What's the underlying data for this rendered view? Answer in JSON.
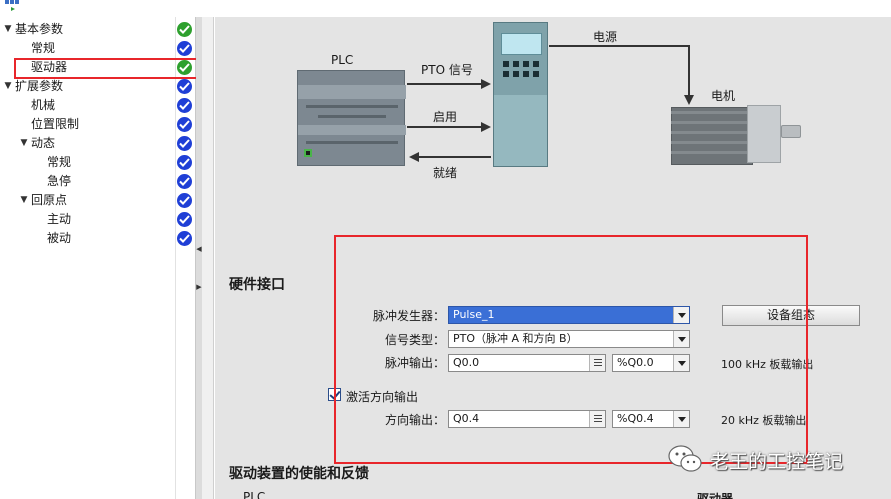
{
  "tree": {
    "items": [
      {
        "label": "基本参数",
        "level": 0,
        "expanded": true,
        "status": "ok"
      },
      {
        "label": "常规",
        "level": 1,
        "expanded": null,
        "status": "blue"
      },
      {
        "label": "驱动器",
        "level": 1,
        "expanded": null,
        "status": "ok",
        "selected": true
      },
      {
        "label": "扩展参数",
        "level": 0,
        "expanded": true,
        "status": "blue"
      },
      {
        "label": "机械",
        "level": 1,
        "expanded": null,
        "status": "blue"
      },
      {
        "label": "位置限制",
        "level": 1,
        "expanded": null,
        "status": "blue"
      },
      {
        "label": "动态",
        "level": 1,
        "expanded": true,
        "status": "blue"
      },
      {
        "label": "常规",
        "level": 2,
        "expanded": null,
        "status": "blue"
      },
      {
        "label": "急停",
        "level": 2,
        "expanded": null,
        "status": "blue"
      },
      {
        "label": "回原点",
        "level": 1,
        "expanded": true,
        "status": "blue"
      },
      {
        "label": "主动",
        "level": 2,
        "expanded": null,
        "status": "blue"
      },
      {
        "label": "被动",
        "level": 2,
        "expanded": null,
        "status": "blue"
      }
    ]
  },
  "diagram": {
    "plc_label": "PLC",
    "power_label": "电源",
    "motor_label": "电机",
    "pto_label": "PTO 信号",
    "enable_label": "启用",
    "ready_label": "就绪"
  },
  "hardware": {
    "title": "硬件接口",
    "pulse_generator_label": "脉冲发生器：",
    "pulse_generator_value": "Pulse_1",
    "config_button": "设备组态",
    "signal_type_label": "信号类型：",
    "signal_type_value": "PTO（脉冲 A 和方向 B）",
    "pulse_output_label": "脉冲输出：",
    "pulse_output_value": "Q0.0",
    "pulse_output_addr": "%Q0.0",
    "pulse_output_note": "100 kHz 板载输出",
    "activate_direction_label": "激活方向输出",
    "activate_direction_checked": true,
    "direction_output_label": "方向输出：",
    "direction_output_value": "Q0.4",
    "direction_output_addr": "%Q0.4",
    "direction_output_note": "20 kHz 板载输出"
  },
  "feedback": {
    "title": "驱动装置的使能和反馈",
    "plc_col": "PLC",
    "drive_col": "驱动器"
  },
  "watermark": {
    "text": "老王的工控笔记",
    "icon": "wechat-icon"
  },
  "colors": {
    "highlight": "#e8262b",
    "status_ok": "#2ea02e",
    "status_blue": "#1f3fd6",
    "selected_field": "#3a6fd6"
  }
}
